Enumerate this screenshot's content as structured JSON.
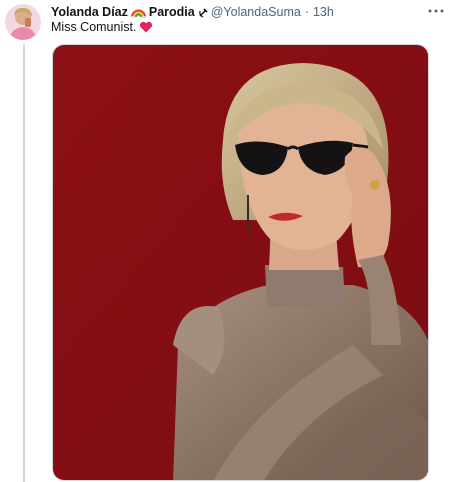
{
  "tweet": {
    "author_name": "Yolanda Díaz",
    "author_suffix": "Parodia",
    "handle": "@YolandaSuma",
    "separator": "·",
    "timestamp": "13h",
    "text": "Miss Comunist."
  },
  "icons": {
    "rainbow": "rainbow-emoji",
    "sickle": "hammer-sickle-emoji",
    "heart": "red-heart-emoji",
    "more": "more-icon"
  },
  "colors": {
    "background_red": "#8a0f14",
    "heart": "#e0245e",
    "secondary_text": "#536471"
  }
}
